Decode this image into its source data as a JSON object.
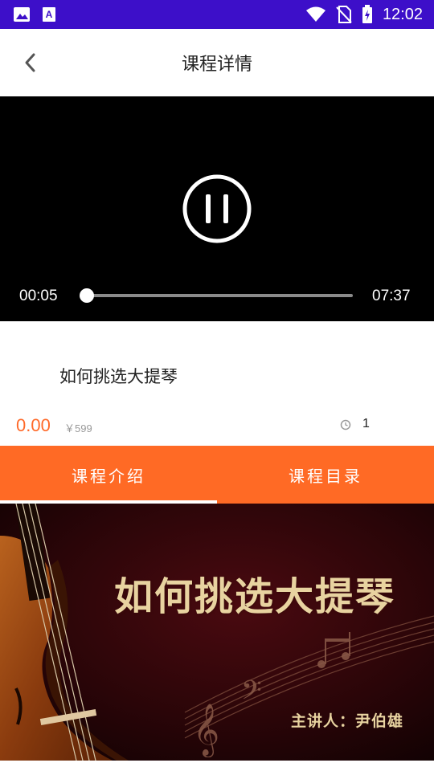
{
  "status_bar": {
    "time": "12:02",
    "background": "#3d0fc9",
    "icons": [
      "image-icon",
      "text-a-icon",
      "wifi-icon",
      "no-sim-icon",
      "battery-charging-icon"
    ]
  },
  "header": {
    "title": "课程详情",
    "back_icon": "chevron-left-icon"
  },
  "player": {
    "current_time": "00:05",
    "total_time": "07:37",
    "progress_fraction": 0.011,
    "state_icon": "pause-icon"
  },
  "course": {
    "title": "如何挑选大提琴",
    "price": "0.00",
    "original_price": "￥599",
    "lesson_count": "1",
    "lesson_icon": "clock-icon"
  },
  "tabs": [
    {
      "label": "课程介绍",
      "active": true
    },
    {
      "label": "课程目录",
      "active": false
    }
  ],
  "banner": {
    "title": "如何挑选大提琴",
    "lecturer": "主讲人：尹伯雄"
  },
  "colors": {
    "accent": "#ff6a25",
    "price": "#ff6a2a",
    "status_bar": "#3d0fc9",
    "banner_text": "#e8d3a0"
  }
}
